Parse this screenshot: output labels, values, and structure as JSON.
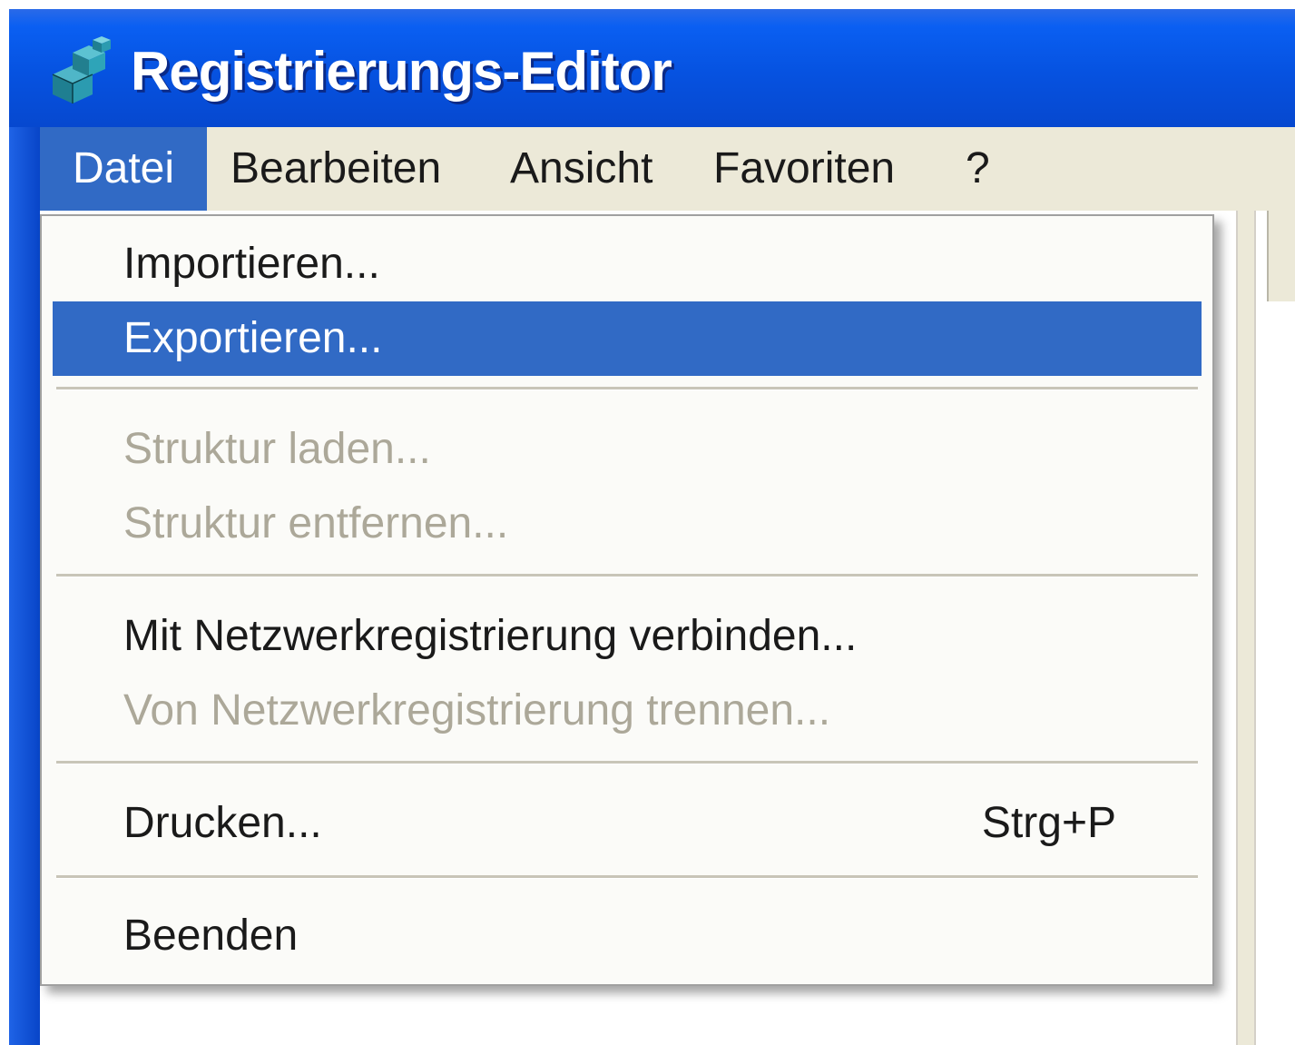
{
  "window": {
    "title": "Registrierungs-Editor",
    "app_icon": "registry-cubes-icon"
  },
  "menubar": {
    "items": [
      {
        "label": "Datei",
        "open": true
      },
      {
        "label": "Bearbeiten"
      },
      {
        "label": "Ansicht"
      },
      {
        "label": "Favoriten"
      },
      {
        "label": "?"
      }
    ]
  },
  "file_menu": {
    "items": [
      {
        "label": "Importieren...",
        "enabled": true
      },
      {
        "label": "Exportieren...",
        "enabled": true,
        "highlighted": true
      },
      {
        "label": "Struktur laden...",
        "enabled": false
      },
      {
        "label": "Struktur entfernen...",
        "enabled": false
      },
      {
        "label": "Mit Netzwerkregistrierung verbinden...",
        "enabled": true
      },
      {
        "label": "Von Netzwerkregistrierung trennen...",
        "enabled": false
      },
      {
        "label": "Drucken...",
        "enabled": true,
        "shortcut": "Strg+P"
      },
      {
        "label": "Beenden",
        "enabled": true
      }
    ]
  },
  "colors": {
    "titlebar": "#0652e0",
    "selection": "#316ac5",
    "disabled_text": "#aca899",
    "menubar_bg": "#ece9d8"
  }
}
